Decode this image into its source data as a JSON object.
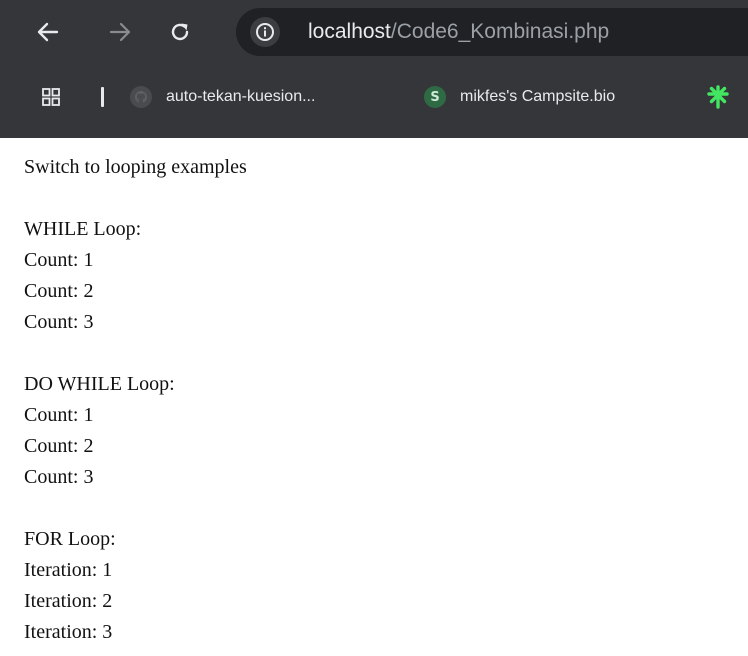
{
  "browser": {
    "url_host": "localhost",
    "url_path": "/Code6_Kombinasi.php",
    "bookmarks": [
      {
        "label": "auto-tekan-kuesion...",
        "icon": "github-icon"
      },
      {
        "label": "mikfes's Campsite.bio",
        "icon": "campsite-icon",
        "badge": "S"
      },
      {
        "label": "",
        "icon": "linktree-icon"
      }
    ],
    "colors": {
      "chrome_bg": "#35363a",
      "omnibox_bg": "#202124",
      "linktree_green": "#43e660"
    }
  },
  "page": {
    "intro": "Switch to looping examples",
    "while_header": "WHILE Loop:",
    "while_lines": [
      "Count: 1",
      "Count: 2",
      "Count: 3"
    ],
    "dowhile_header": "DO WHILE Loop:",
    "dowhile_lines": [
      "Count: 1",
      "Count: 2",
      "Count: 3"
    ],
    "for_header": "FOR Loop:",
    "for_lines": [
      "Iteration: 1",
      "Iteration: 2",
      "Iteration: 3"
    ]
  }
}
